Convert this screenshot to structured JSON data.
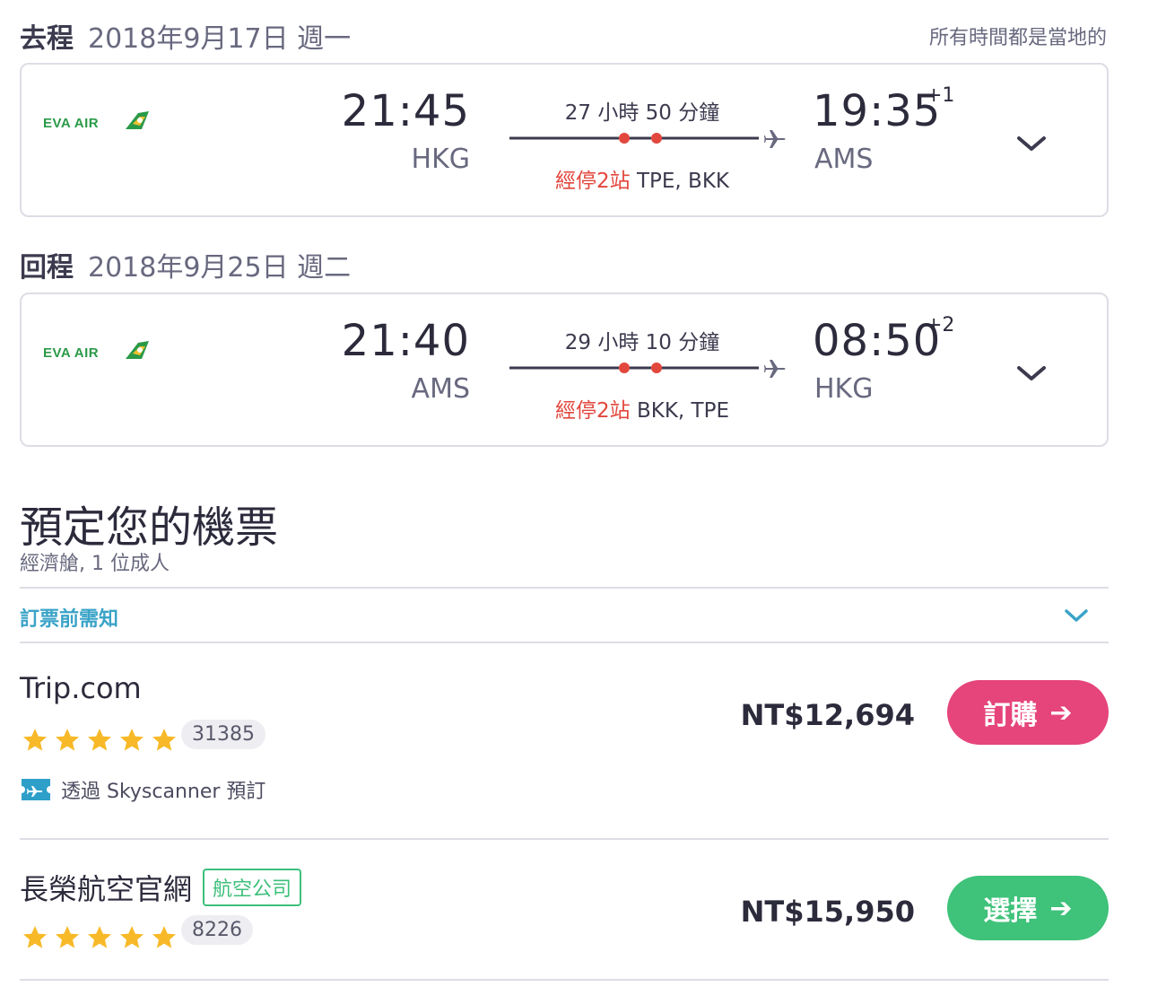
{
  "outbound": {
    "label": "去程",
    "date": "2018年9月17日 週一",
    "local_time_note": "所有時間都是當地的",
    "airline_logo": "EVA AIR",
    "dep_time": "21:45",
    "dep_code": "HKG",
    "duration": "27 小時 50 分鐘",
    "stops_count": "經停2站",
    "stops_airports": " TPE, BKK",
    "arr_time": "19:35",
    "day_offset": "+1",
    "arr_code": "AMS"
  },
  "inbound": {
    "label": "回程",
    "date": "2018年9月25日 週二",
    "airline_logo": "EVA AIR",
    "dep_time": "21:40",
    "dep_code": "AMS",
    "duration": "29 小時 10 分鐘",
    "stops_count": "經停2站",
    "stops_airports": " BKK, TPE",
    "arr_time": "08:50",
    "day_offset": "+2",
    "arr_code": "HKG"
  },
  "booking": {
    "title": "預定您的機票",
    "subtitle": "經濟艙, 1 位成人",
    "notice_label": "訂票前需知"
  },
  "providers": [
    {
      "name": "Trip.com",
      "rating_stars": 5,
      "review_count": "31385",
      "via_text": "透過 Skyscanner 預訂",
      "price": "NT$12,694",
      "button_label": "訂購",
      "button_color": "#e5457a"
    },
    {
      "name": "長榮航空官網",
      "tag": "航空公司",
      "rating_stars": 5,
      "review_count": "8226",
      "price": "NT$15,950",
      "button_label": "選擇",
      "button_color": "#3fc27a"
    }
  ],
  "colors": {
    "stops_red": "#e2473d",
    "notice_blue": "#3aa3c7",
    "star_yellow": "#f7b928",
    "eva_green": "#2a9a47"
  },
  "icons": [
    "eva-air-logo",
    "plane-icon",
    "chevron-down-icon",
    "star-icon",
    "skyscanner-ticket-icon",
    "arrow-right-icon"
  ]
}
